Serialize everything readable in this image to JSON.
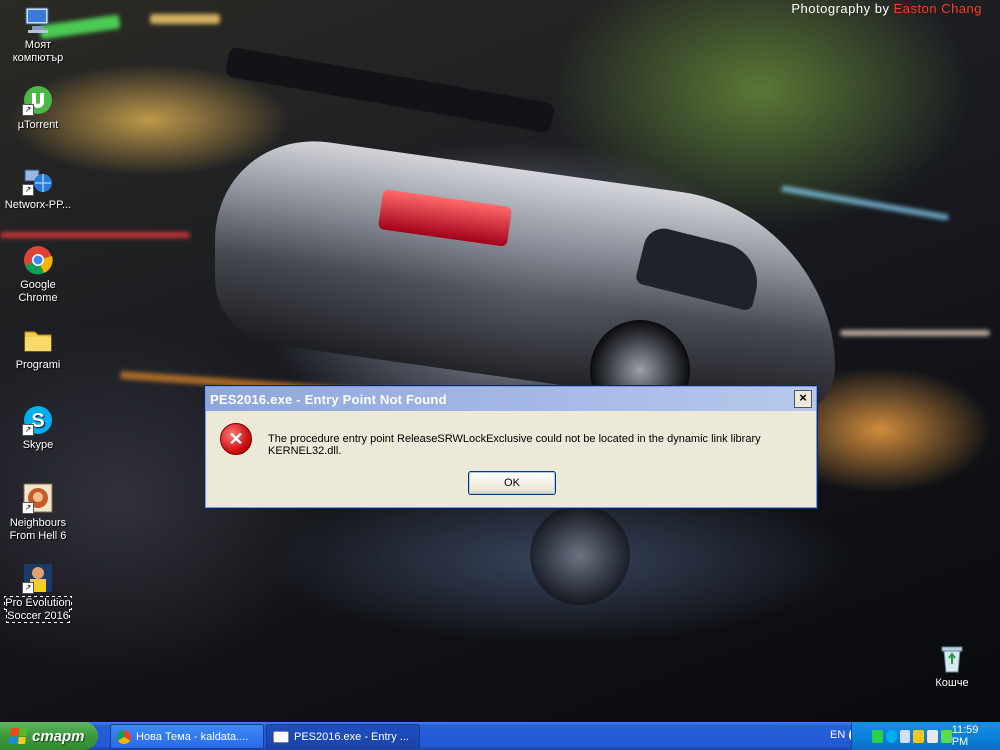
{
  "wallpaper": {
    "credit_prefix": "Photography by",
    "credit_name": "Easton Chang"
  },
  "desktop_icons": [
    {
      "label": "Моят компютър",
      "icon": "my-computer-icon"
    },
    {
      "label": "µTorrent",
      "icon": "utorrent-icon"
    },
    {
      "label": "Networx-PP...",
      "icon": "networx-icon"
    },
    {
      "label": "Google Chrome",
      "icon": "chrome-icon"
    },
    {
      "label": "Programi",
      "icon": "folder-icon"
    },
    {
      "label": "Skype",
      "icon": "skype-icon"
    },
    {
      "label": "Neighbours From Hell 6",
      "icon": "game-icon"
    },
    {
      "label": "Pro Evolution Soccer 2016",
      "icon": "pes-icon"
    },
    {
      "label": "Кошче",
      "icon": "recycle-bin-icon"
    }
  ],
  "dialog": {
    "title": "PES2016.exe - Entry Point Not Found",
    "close_glyph": "×",
    "message": "The procedure entry point ReleaseSRWLockExclusive could not be located in the dynamic link library KERNEL32.dll.",
    "ok_label": "OK",
    "error_glyph": "✕"
  },
  "taskbar": {
    "start_label": "старт",
    "tasks": [
      {
        "label": "Нова Тема - kaldata....",
        "icon": "chrome-icon"
      },
      {
        "label": "PES2016.exe - Entry ...",
        "icon": "window-icon"
      }
    ],
    "language": "EN",
    "clock": "11:59 PM"
  },
  "colors": {
    "taskbar_blue": "#245edb",
    "start_green": "#3c9a3c",
    "tray_blue": "#0d7fd8",
    "dialog_face": "#ece9d8",
    "error_red": "#d01010"
  }
}
